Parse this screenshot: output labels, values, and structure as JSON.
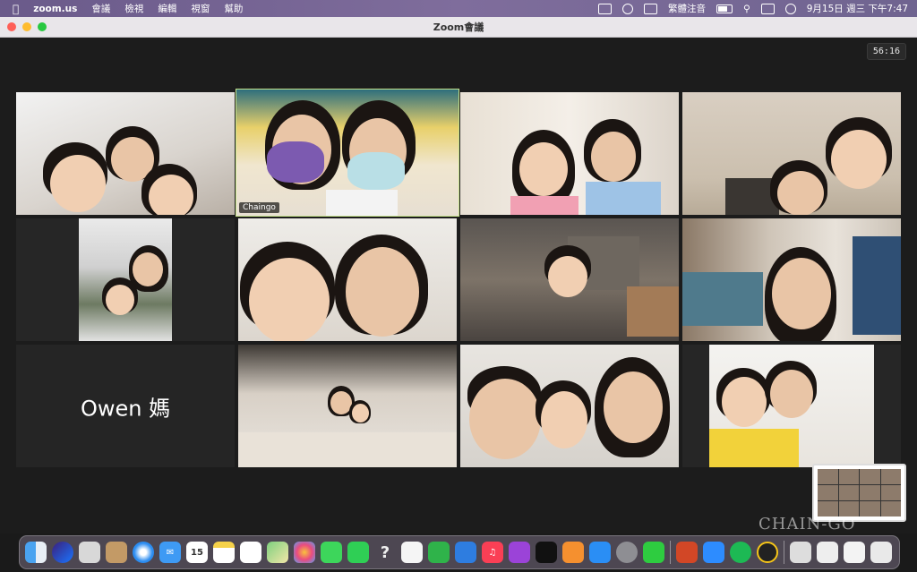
{
  "menubar": {
    "app_name": "zoom.us",
    "menus": [
      "會議",
      "檢視",
      "編輯",
      "視窗",
      "幫助"
    ],
    "input_method": "繁體注音",
    "datetime": "9月15日 週三 下午7:47"
  },
  "window": {
    "title": "Zoom會議",
    "timer": "56:16"
  },
  "participants": {
    "tile2_name": "Chaingo",
    "tile9_name": "Owen 媽"
  },
  "dock": {
    "calendar_day": "15"
  },
  "watermark": "CHAIN-GO",
  "colors": {
    "active_speaker_border": "#c5e28a",
    "menubar_bg": "#7f6d9c"
  }
}
